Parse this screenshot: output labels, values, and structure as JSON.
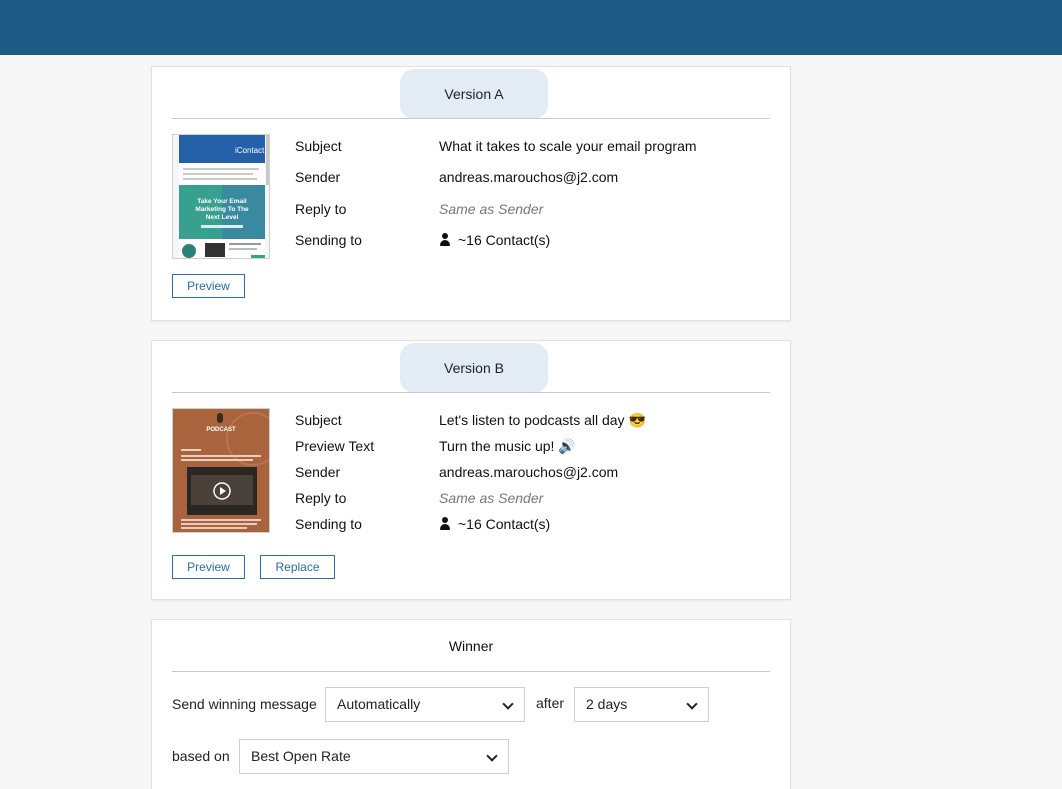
{
  "version_a": {
    "title": "Version A",
    "thumb": {
      "brand": "iContact",
      "headline": "Take Your Email Marketing To The Next Level"
    },
    "fields": [
      {
        "label": "Subject",
        "value": "What it takes to scale your email program"
      },
      {
        "label": "Sender",
        "value": "andreas.marouchos@j2.com"
      },
      {
        "label": "Reply to",
        "value": "Same as Sender"
      },
      {
        "label": "Sending to",
        "value": "~16 Contact(s)"
      }
    ],
    "preview_label": "Preview"
  },
  "version_b": {
    "title": "Version B",
    "thumb": {
      "headline": "PODCAST"
    },
    "fields": [
      {
        "label": "Subject",
        "value": "Let's listen to podcasts all day 😎"
      },
      {
        "label": "Preview Text",
        "value": "Turn the music up! 🔊"
      },
      {
        "label": "Sender",
        "value": "andreas.marouchos@j2.com"
      },
      {
        "label": "Reply to",
        "value": "Same as Sender"
      },
      {
        "label": "Sending to",
        "value": "~16 Contact(s)"
      }
    ],
    "preview_label": "Preview",
    "replace_label": "Replace"
  },
  "winner": {
    "title": "Winner",
    "send_label": "Send winning message",
    "send_value": "Automatically",
    "after_label": "after",
    "after_value": "2 days",
    "based_label": "based on",
    "based_value": "Best Open Rate"
  },
  "colors": {
    "topbar": "#1f5a87",
    "accent": "#2a6fa8",
    "pill": "#e3ebf4"
  }
}
